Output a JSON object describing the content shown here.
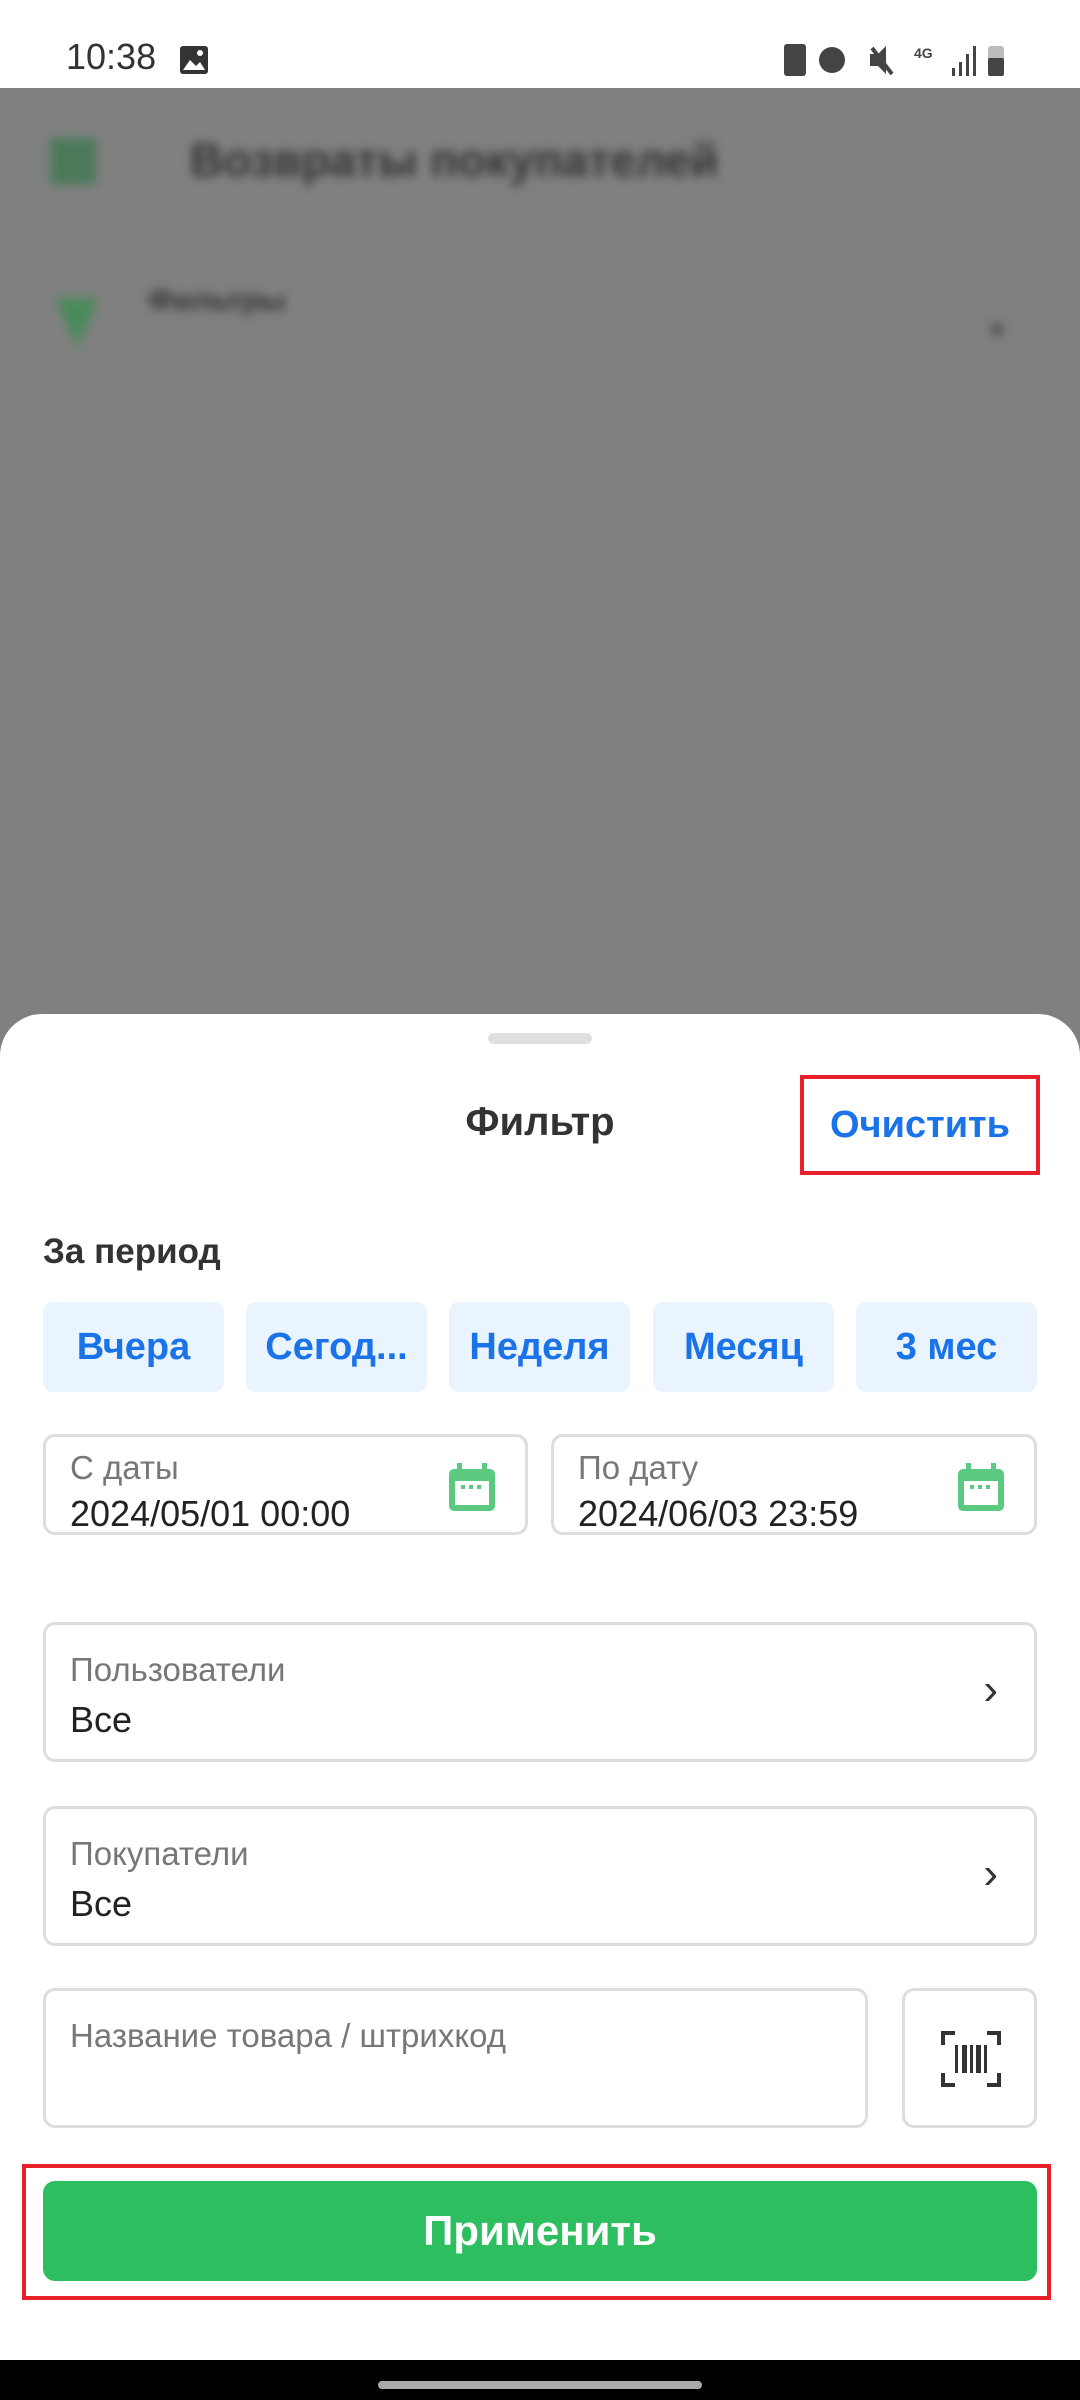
{
  "status_bar": {
    "time": "10:38"
  },
  "background": {
    "title": "Возвраты покупателей",
    "filters_label": "Фильтры"
  },
  "sheet": {
    "title": "Фильтр",
    "clear_label": "Очистить",
    "period_label": "За период",
    "period_chips": [
      "Вчера",
      "Сегод...",
      "Неделя",
      "Месяц",
      "3 мес"
    ],
    "from_date": {
      "label": "С даты",
      "value": "2024/05/01 00:00"
    },
    "to_date": {
      "label": "По дату",
      "value": "2024/06/03 23:59"
    },
    "users": {
      "label": "Пользователи",
      "value": "Все"
    },
    "buyers": {
      "label": "Покупатели",
      "value": "Все"
    },
    "product": {
      "placeholder": "Название товара / штрихкод"
    },
    "apply_label": "Применить"
  },
  "colors": {
    "accent_blue": "#1a73e8",
    "green": "#2dbe60",
    "highlight": "#e8202a"
  }
}
